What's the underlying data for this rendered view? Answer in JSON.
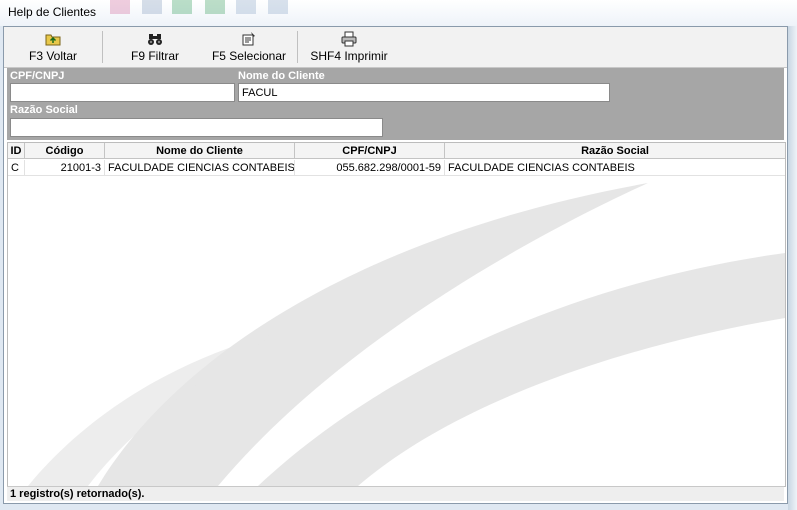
{
  "window": {
    "title": "Help de Clientes"
  },
  "toolbar": {
    "buttons": [
      {
        "label": "F3 Voltar",
        "icon": "back-folder-icon"
      },
      {
        "label": "F9 Filtrar",
        "icon": "binoculars-icon"
      },
      {
        "label": "F5 Selecionar",
        "icon": "select-icon"
      },
      {
        "label": "SHF4 Imprimir",
        "icon": "printer-icon"
      }
    ]
  },
  "filters": {
    "cpf_label": "CPF/CNPJ",
    "cpf_value": "",
    "nome_label": "Nome do Cliente",
    "nome_value": "FACUL",
    "razao_label": "Razão Social",
    "razao_value": ""
  },
  "grid": {
    "columns": [
      "ID",
      "Código",
      "Nome do Cliente",
      "CPF/CNPJ",
      "Razão Social"
    ],
    "rows": [
      {
        "id": "C",
        "codigo": "21001-3",
        "nome": "FACULDADE CIENCIAS CONTABEIS",
        "cpf": "055.682.298/0001-59",
        "razao": "FACULDADE CIENCIAS CONTABEIS"
      }
    ]
  },
  "status": {
    "text": "1 registro(s) retornado(s)."
  },
  "colors": {
    "filter_panel": "#a6a6a6",
    "label_text": "#ffffff",
    "swoosh": "#d9d9d9"
  }
}
